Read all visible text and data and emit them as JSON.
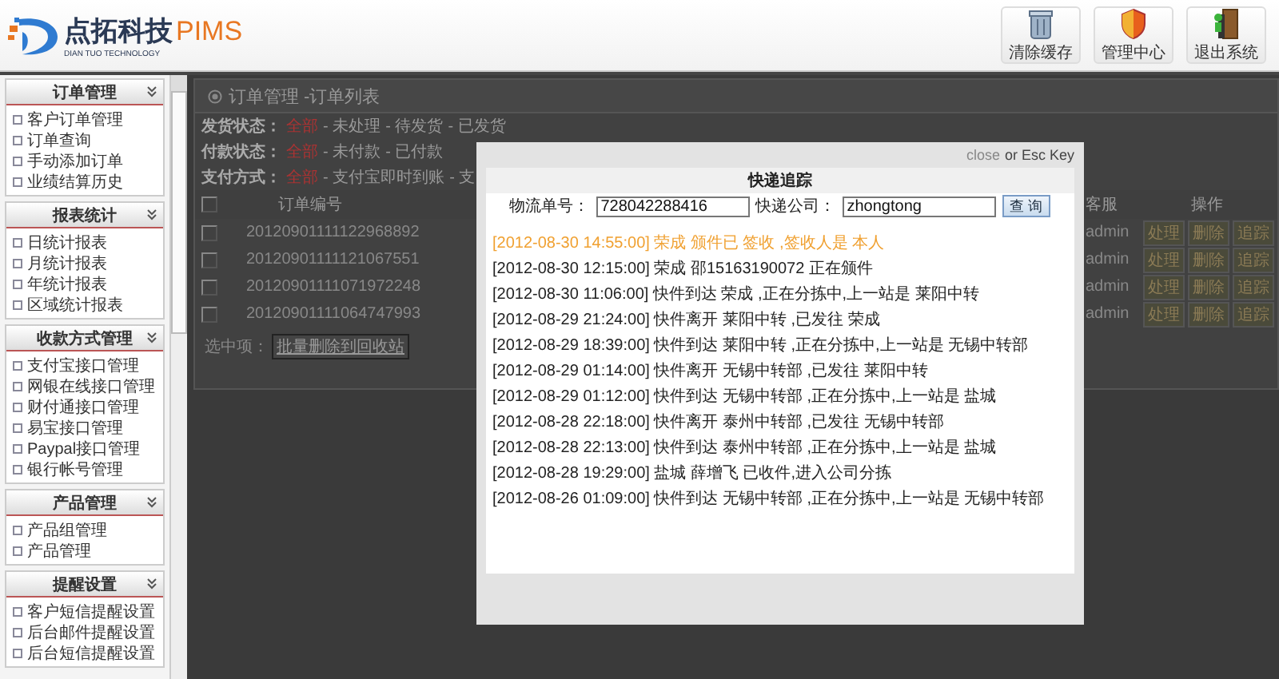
{
  "header": {
    "logo_name": "点拓科技",
    "logo_suffix": "PIMS",
    "logo_subtitle": "DIAN TUO TECHNOLOGY",
    "buttons": [
      {
        "kind": "cache",
        "label": "清除缓存"
      },
      {
        "kind": "admin",
        "label": "管理中心"
      },
      {
        "kind": "exit",
        "label": "退出系统"
      }
    ]
  },
  "sidebar": {
    "sections": [
      {
        "title": "订单管理",
        "items": [
          "客户订单管理",
          "订单查询",
          "手动添加订单",
          "业绩结算历史"
        ]
      },
      {
        "title": "报表统计",
        "items": [
          "日统计报表",
          "月统计报表",
          "年统计报表",
          "区域统计报表"
        ]
      },
      {
        "title": "收款方式管理",
        "items": [
          "支付宝接口管理",
          "网银在线接口管理",
          "财付通接口管理",
          "易宝接口管理",
          "Paypal接口管理",
          "银行帐号管理"
        ]
      },
      {
        "title": "产品管理",
        "items": [
          "产品组管理",
          "产品管理"
        ]
      },
      {
        "title": "提醒设置",
        "items": [
          "客户短信提醒设置",
          "后台邮件提醒设置",
          "后台短信提醒设置"
        ]
      }
    ]
  },
  "main": {
    "title": "订单管理 -订单列表",
    "filters": [
      {
        "label": "发货状态：",
        "options": [
          {
            "text": "全部",
            "selected": true
          },
          {
            "text": "- 未处理",
            "selected": false
          },
          {
            "text": "- 待发货",
            "selected": false
          },
          {
            "text": "- 已发货",
            "selected": false
          }
        ]
      },
      {
        "label": "付款状态：",
        "options": [
          {
            "text": "全部",
            "selected": true
          },
          {
            "text": "- 未付款",
            "selected": false
          },
          {
            "text": "- 已付款",
            "selected": false
          }
        ]
      },
      {
        "label": "支付方式：",
        "options": [
          {
            "text": "全部",
            "selected": true
          },
          {
            "text": "- 支付宝即时到账",
            "selected": false
          },
          {
            "text": "- 支",
            "selected": false
          }
        ]
      }
    ],
    "table": {
      "select_all_checked": false,
      "columns": [
        "订单编号",
        "客服",
        "操作"
      ],
      "rows": [
        {
          "checked": false,
          "order_no": "20120901111122968892",
          "agent": "admin",
          "actions": [
            "处理",
            "删除",
            "追踪"
          ]
        },
        {
          "checked": false,
          "order_no": "20120901111121067551",
          "agent": "admin",
          "actions": [
            "处理",
            "删除",
            "追踪"
          ]
        },
        {
          "checked": false,
          "order_no": "20120901111071972248",
          "agent": "admin",
          "actions": [
            "处理",
            "删除",
            "追踪"
          ]
        },
        {
          "checked": false,
          "order_no": "20120901111064747993",
          "agent": "admin",
          "actions": [
            "处理",
            "删除",
            "追踪"
          ]
        }
      ]
    },
    "selection": {
      "label": "选中项：",
      "button": "批量删除到回收站"
    }
  },
  "dialog": {
    "close_link": "close",
    "close_hint": "or Esc Key",
    "title": "快递追踪",
    "fields": [
      {
        "label": "物流单号：",
        "value": "728042288416"
      },
      {
        "label": "快递公司：",
        "value": "zhongtong"
      }
    ],
    "query_button": "查 询",
    "events": [
      {
        "text": "[2012-08-30 14:55:00] 荣成 颁件已 签收 ,签收人是 本人",
        "latest": true
      },
      {
        "text": "[2012-08-30 12:15:00] 荣成 邵15163190072 正在颁件",
        "latest": false
      },
      {
        "text": "[2012-08-30 11:06:00] 快件到达 荣成 ,正在分拣中,上一站是 莱阳中转",
        "latest": false
      },
      {
        "text": "[2012-08-29 21:24:00] 快件离开 莱阳中转 ,已发往 荣成",
        "latest": false
      },
      {
        "text": "[2012-08-29 18:39:00] 快件到达 莱阳中转 ,正在分拣中,上一站是 无锡中转部",
        "latest": false
      },
      {
        "text": "[2012-08-29 01:14:00] 快件离开 无锡中转部 ,已发往 莱阳中转",
        "latest": false
      },
      {
        "text": "[2012-08-29 01:12:00] 快件到达 无锡中转部 ,正在分拣中,上一站是 盐城",
        "latest": false
      },
      {
        "text": "[2012-08-28 22:18:00] 快件离开 泰州中转部 ,已发往 无锡中转部",
        "latest": false
      },
      {
        "text": "[2012-08-28 22:13:00] 快件到达 泰州中转部 ,正在分拣中,上一站是 盐城",
        "latest": false
      },
      {
        "text": "[2012-08-28 19:29:00] 盐城 薛增飞 已收件,进入公司分拣",
        "latest": false
      },
      {
        "text": "[2012-08-26 01:09:00] 快件到达 无锡中转部 ,正在分拣中,上一站是 无锡中转部",
        "latest": false
      }
    ]
  }
}
